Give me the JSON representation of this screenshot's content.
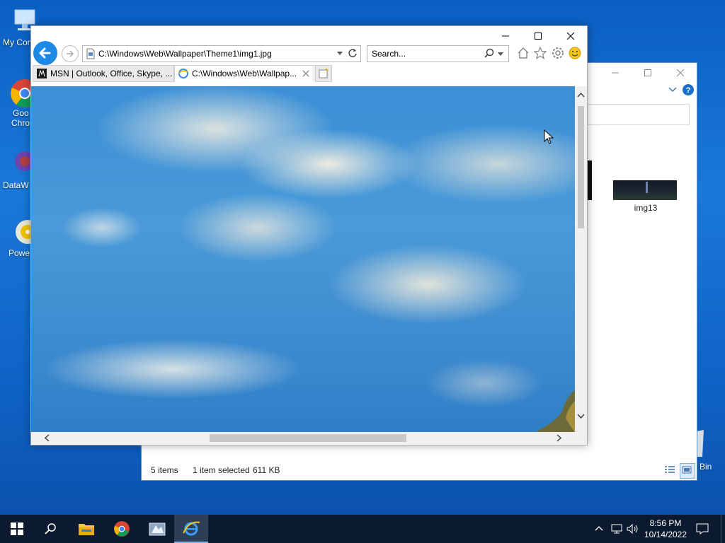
{
  "desktop": {
    "icons": [
      {
        "label_line1": "My Com",
        "label_line2": ""
      },
      {
        "label_line1": "Goo",
        "label_line2": "Chro"
      },
      {
        "label_line1": "DataW",
        "label_line2": ""
      },
      {
        "label_line1": "Powe",
        "label_line2": ""
      },
      {
        "label_line1": "Bin",
        "label_line2": ""
      }
    ]
  },
  "explorer": {
    "file_label": "img13",
    "status_items": "5 items",
    "status_selected": "1 item selected",
    "status_size": "611 KB"
  },
  "ie": {
    "address": "C:\\Windows\\Web\\Wallpaper\\Theme1\\img1.jpg",
    "search_placeholder": "Search...",
    "tabs": [
      {
        "label": "MSN | Outlook, Office, Skype, ..."
      },
      {
        "label": "C:\\Windows\\Web\\Wallpap..."
      }
    ]
  },
  "taskbar": {
    "time": "8:56 PM",
    "date": "10/14/2022"
  },
  "colors": {
    "desktop_blue": "#0f63c6",
    "taskbar": "#0b1a2e",
    "ie_back_button": "#1e88e5"
  }
}
